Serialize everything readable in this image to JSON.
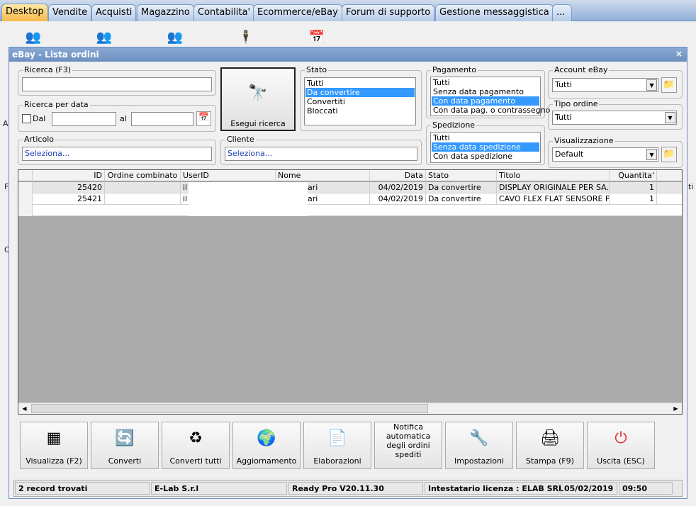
{
  "tabs": [
    "Desktop",
    "Vendite",
    "Acquisti",
    "Magazzino",
    "Contabilita'",
    "Ecommerce/eBay",
    "Forum di supporto",
    "Gestione messaggistica",
    "..."
  ],
  "window": {
    "title": "eBay - Lista ordini",
    "close": "×"
  },
  "ricerca": {
    "label": "Ricerca (F3)",
    "value": ""
  },
  "ricerca_data": {
    "label": "Ricerca per data",
    "dal": "Dal",
    "al": "al"
  },
  "search_button": "Esegui ricerca",
  "stato": {
    "label": "Stato",
    "options": [
      "Tutti",
      "Da convertire",
      "Convertiti",
      "Bloccati"
    ],
    "selected": "Da convertire"
  },
  "pagamento": {
    "label": "Pagamento",
    "options": [
      "Tutti",
      "Senza data pagamento",
      "Con data pagamento",
      "Con data pag. o contrassegno"
    ],
    "selected": "Con data pagamento"
  },
  "spedizione": {
    "label": "Spedizione",
    "options": [
      "Tutti",
      "Senza data spedizione",
      "Con data spedizione"
    ],
    "selected": "Senza data spedizione"
  },
  "account": {
    "label": "Account eBay",
    "value": "Tutti"
  },
  "tipo_ordine": {
    "label": "Tipo ordine",
    "value": "Tutti"
  },
  "visualizzazione": {
    "label": "Visualizzazione",
    "value": "Default"
  },
  "articolo": {
    "label": "Articolo",
    "value": "Seleziona..."
  },
  "cliente": {
    "label": "Cliente",
    "value": "Seleziona..."
  },
  "grid": {
    "columns": [
      "ID",
      "Ordine combinato",
      "UserID",
      "Nome",
      "Data",
      "Stato",
      "Titolo",
      "Quantita'"
    ],
    "rows": [
      {
        "id": "25420",
        "ordine": "",
        "userid": "il",
        "nome": "ari",
        "data": "04/02/2019",
        "stato": "Da convertire",
        "titolo": "DISPLAY ORIGINALE PER SA...",
        "qty": "1"
      },
      {
        "id": "25421",
        "ordine": "",
        "userid": "il",
        "nome": "ari",
        "data": "04/02/2019",
        "stato": "Da convertire",
        "titolo": "CAVO FLEX FLAT SENSORE P...",
        "qty": "1"
      }
    ]
  },
  "buttons": [
    "Visualizza (F2)",
    "Converti",
    "Converti tutti",
    "Aggiornamento",
    "Elaborazioni",
    "Notifica automatica degli ordini spediti",
    "Impostazioni",
    "Stampa (F9)",
    "Uscita (ESC)"
  ],
  "status": {
    "records": "2 record trovati",
    "company": "E-Lab S.r.l",
    "version": "Ready Pro V20.11.30",
    "license": "Intestatario licenza : ELAB SRL",
    "date": "05/02/2019",
    "time": "09:50"
  },
  "edge_labels": [
    "Ar",
    "F",
    "O",
    "ti"
  ]
}
